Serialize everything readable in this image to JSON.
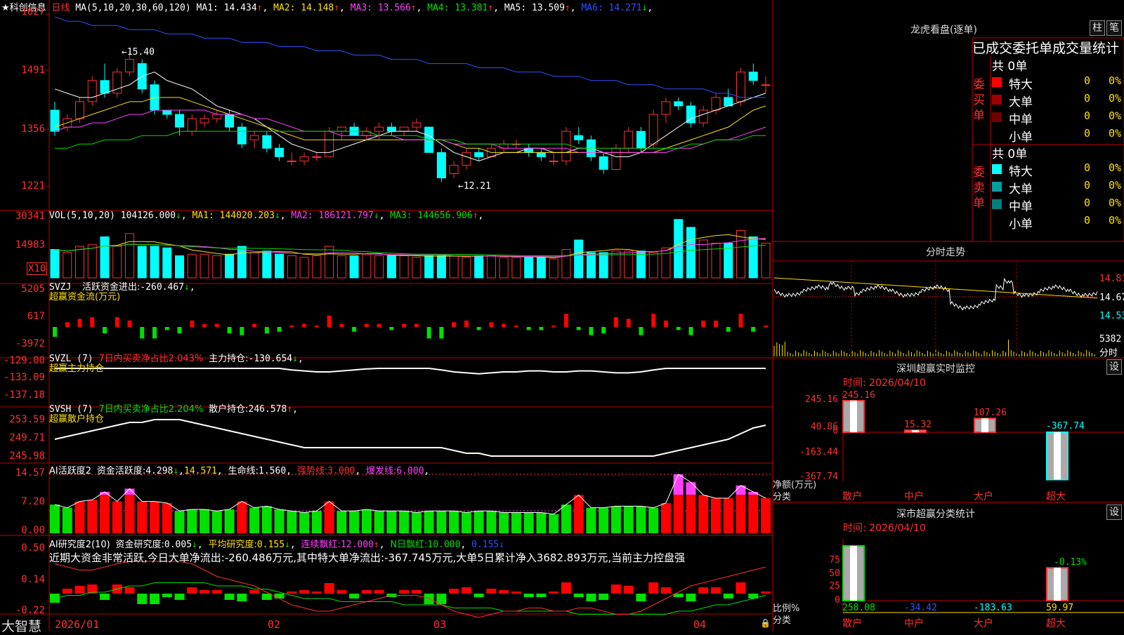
{
  "stock": {
    "name": "科创信息",
    "period": "日线",
    "star": "★"
  },
  "header": {
    "ma_label": "MA(5,10,20,30,60,120)",
    "ma": [
      {
        "name": "MA1",
        "value": "14.434",
        "arrow": "↑",
        "color": "#ffffff"
      },
      {
        "name": "MA2",
        "value": "14.148",
        "arrow": "↑",
        "color": "#ffe000"
      },
      {
        "name": "MA3",
        "value": "13.566",
        "arrow": "↑",
        "color": "#ff40ff"
      },
      {
        "name": "MA4",
        "value": "13.381",
        "arrow": "↑",
        "color": "#00e000"
      },
      {
        "name": "MA5",
        "value": "13.509",
        "arrow": "↑",
        "color": "#ffffff"
      },
      {
        "name": "MA6",
        "value": "14.271",
        "arrow": "↓",
        "color": "#3050ff"
      }
    ]
  },
  "price_axis": [
    "1627",
    "1491",
    "1356",
    "1221"
  ],
  "price_marks": {
    "high": "15.40",
    "low": "12.21"
  },
  "vol": {
    "label": "VOL(5,10,20)",
    "value": "104126.000",
    "arrow": "↓",
    "ma": [
      {
        "name": "MA1",
        "value": "144020.203",
        "arrow": "↓",
        "color": "#ffe000"
      },
      {
        "name": "MA2",
        "value": "186121.797",
        "arrow": "↓",
        "color": "#ff40ff"
      },
      {
        "name": "MA3",
        "value": "144656.906",
        "arrow": "↑",
        "color": "#00e000"
      }
    ],
    "axis": [
      "30341",
      "14983"
    ],
    "unit": "X10"
  },
  "svzj": {
    "label": "SVZJ",
    "text": "活跃资金进出:",
    "value": "-260.467",
    "arrow": "↓",
    "sub": "超赢资金流(万元)",
    "axis": [
      "5205",
      "617",
      "-3972"
    ]
  },
  "svzl": {
    "label": "SVZL (7)",
    "pct_text": "7日内买卖净占比2.043%",
    "text": "主力持仓:",
    "value": "-130.654",
    "arrow": "↓",
    "sub": "超赢主力持仓",
    "axis": [
      "-129.00",
      "-133.09",
      "-137.18"
    ]
  },
  "svsh": {
    "label": "SVSH (7)",
    "pct_text": "7日内买卖净占比2.204%",
    "text": "散户持仓:",
    "value": "246.578",
    "arrow": "↑",
    "sub": "超赢散户持仓",
    "axis": [
      "253.59",
      "249.71",
      "245.98"
    ]
  },
  "ai1": {
    "label": "AI活跃度2",
    "text": "资金活跃度:",
    "value": "4.298",
    "arrow": "↓",
    "v2": "14.571",
    "t3": "生命线:",
    "v3": "1.560",
    "t4": "强势线:",
    "v4": "3.000",
    "t5": "爆发线:",
    "v5": "6.000",
    "axis": [
      "14.57",
      "7.20",
      "0.00"
    ]
  },
  "ai2": {
    "label": "AI研究度2(10)",
    "text": "资金研究度:",
    "value": "0.005",
    "arrow": "↓",
    "t2": "平均研究度:",
    "v2": "0.155",
    "a2": "↓",
    "t3": "连续飘红:",
    "v3": "12.000",
    "a3": "↑",
    "t4": "N日飘红:",
    "v4": "10.000",
    "v5": "0.155",
    "a5": "↓",
    "comment": "近期大资金非常活跃,今日大单净流出:-260.486万元,其中特大单净流出:-367.745万元,大单5日累计净入3682.893万元,当前主力控盘强",
    "axis": [
      "0.50",
      "0.14",
      "-0.22"
    ]
  },
  "dates": [
    "2026/01",
    "02",
    "03",
    "04"
  ],
  "brand": "大智慧",
  "right": {
    "lhb_title": "龙虎看盘(逐单)",
    "buttons": [
      "柱",
      "笔"
    ],
    "stat_title": "已成交委托单成交量统计",
    "buy": {
      "side": "委买单",
      "total": "共 0单",
      "rows": [
        {
          "name": "特大",
          "v": "0",
          "p": "0%",
          "color": "#ff0000"
        },
        {
          "name": "大单",
          "v": "0",
          "p": "0%",
          "color": "#a00000"
        },
        {
          "name": "中单",
          "v": "0",
          "p": "0%",
          "color": "#700000"
        },
        {
          "name": "小单",
          "v": "0",
          "p": "0%",
          "color": "#000000"
        }
      ]
    },
    "sell": {
      "side": "委卖单",
      "total": "共 0单",
      "rows": [
        {
          "name": "特大",
          "v": "0",
          "p": "0%",
          "color": "#00ffff"
        },
        {
          "name": "大单",
          "v": "0",
          "p": "0%",
          "color": "#00a0a0"
        },
        {
          "name": "中单",
          "v": "0",
          "p": "0%",
          "color": "#008080"
        },
        {
          "name": "小单",
          "v": "0",
          "p": "0%",
          "color": "#000000"
        }
      ]
    },
    "intraday": {
      "title": "分时走势",
      "p1": "14.81",
      "p2": "14.67",
      "p3": "14.53",
      "vol": "5382",
      "vol_label": "分时"
    },
    "monitor": {
      "title": "深圳超赢实时监控",
      "btn": "设",
      "time": "时间: 2026/04/10",
      "axis": [
        "245.16",
        "40.86",
        "0",
        "-163.44",
        "-367.74"
      ],
      "ylabel": "净额(万元)",
      "xlabel": "分类",
      "bars": [
        {
          "name": "散户",
          "v": "245.16",
          "n": 245.16
        },
        {
          "name": "中户",
          "v": "15.32",
          "n": 15.32
        },
        {
          "name": "大户",
          "v": "107.26",
          "n": 107.26
        },
        {
          "name": "超大",
          "v": "-367.74",
          "n": -367.74
        }
      ]
    },
    "classify": {
      "title": "深市超赢分类统计",
      "btn": "设",
      "time": "时间: 2026/04/10",
      "axis": [
        "75",
        "50",
        "25",
        "0"
      ],
      "ylabel": "比例%",
      "xlabel": "分类",
      "top_label": "-0.13%",
      "bars": [
        {
          "name": "散户",
          "v": "258.08",
          "n": 100,
          "c": "#00e000"
        },
        {
          "name": "中户",
          "v": "-34.42",
          "n": 0,
          "c": "#3050ff"
        },
        {
          "name": "大户",
          "v": "-183.63",
          "n": 0,
          "c": "#00ffff"
        },
        {
          "name": "超大",
          "v": "59.97",
          "n": 59.97,
          "c": "#ffe000"
        }
      ]
    }
  },
  "chart_data": {
    "type": "candlestick",
    "title": "科创信息 日线",
    "x_start": "2026/01",
    "candles": [
      [
        14.0,
        14.2,
        13.4,
        13.5
      ],
      [
        13.6,
        13.9,
        13.5,
        13.8
      ],
      [
        13.8,
        14.3,
        13.7,
        14.2
      ],
      [
        14.2,
        14.8,
        14.1,
        14.7
      ],
      [
        14.7,
        15.1,
        14.3,
        14.4
      ],
      [
        14.4,
        15.0,
        14.3,
        14.9
      ],
      [
        14.9,
        15.4,
        14.8,
        15.2
      ],
      [
        15.1,
        15.2,
        14.4,
        14.5
      ],
      [
        14.6,
        14.7,
        13.9,
        14.0
      ],
      [
        14.0,
        14.0,
        13.8,
        13.9
      ],
      [
        13.9,
        14.0,
        13.4,
        13.6
      ],
      [
        13.5,
        13.9,
        13.4,
        13.8
      ],
      [
        13.7,
        13.9,
        13.6,
        13.8
      ],
      [
        13.8,
        14.0,
        13.7,
        13.9
      ],
      [
        13.9,
        14.0,
        13.5,
        13.6
      ],
      [
        13.6,
        13.7,
        13.1,
        13.2
      ],
      [
        13.3,
        13.5,
        13.1,
        13.4
      ],
      [
        13.4,
        13.5,
        13.0,
        13.1
      ],
      [
        13.1,
        13.2,
        12.8,
        12.9
      ],
      [
        12.8,
        13.0,
        12.7,
        12.8
      ],
      [
        12.8,
        13.0,
        12.7,
        12.9
      ],
      [
        12.9,
        13.0,
        12.8,
        12.9
      ],
      [
        12.9,
        13.6,
        12.9,
        13.5
      ],
      [
        13.5,
        13.6,
        13.3,
        13.6
      ],
      [
        13.6,
        13.7,
        13.4,
        13.4
      ],
      [
        13.4,
        13.6,
        13.3,
        13.5
      ],
      [
        13.5,
        13.7,
        13.3,
        13.6
      ],
      [
        13.6,
        13.7,
        13.4,
        13.5
      ],
      [
        13.5,
        13.6,
        13.4,
        13.6
      ],
      [
        13.6,
        13.8,
        13.5,
        13.7
      ],
      [
        13.6,
        13.6,
        13.0,
        13.0
      ],
      [
        13.0,
        13.1,
        12.3,
        12.4
      ],
      [
        12.5,
        12.8,
        12.4,
        12.7
      ],
      [
        12.7,
        13.1,
        12.6,
        13.0
      ],
      [
        13.0,
        13.1,
        12.8,
        12.9
      ],
      [
        12.9,
        13.2,
        12.9,
        13.1
      ],
      [
        13.1,
        13.3,
        13.0,
        13.2
      ],
      [
        13.2,
        13.3,
        13.1,
        13.2
      ],
      [
        13.1,
        13.2,
        12.9,
        13.0
      ],
      [
        13.0,
        13.1,
        12.8,
        12.9
      ],
      [
        12.8,
        13.0,
        12.7,
        12.8
      ],
      [
        12.8,
        13.6,
        12.7,
        13.5
      ],
      [
        13.4,
        13.6,
        13.2,
        13.3
      ],
      [
        13.3,
        13.4,
        12.8,
        12.9
      ],
      [
        12.9,
        13.0,
        12.5,
        12.6
      ],
      [
        12.6,
        13.2,
        12.6,
        13.1
      ],
      [
        13.1,
        13.6,
        13.0,
        13.5
      ],
      [
        13.5,
        13.6,
        13.0,
        13.1
      ],
      [
        13.2,
        14.0,
        13.1,
        13.9
      ],
      [
        13.9,
        14.3,
        13.7,
        14.2
      ],
      [
        14.2,
        14.3,
        14.0,
        14.1
      ],
      [
        14.1,
        14.2,
        13.6,
        13.7
      ],
      [
        13.7,
        14.1,
        13.6,
        14.0
      ],
      [
        14.0,
        14.4,
        13.9,
        14.3
      ],
      [
        14.3,
        14.5,
        14.1,
        14.1
      ],
      [
        14.2,
        15.0,
        14.1,
        14.9
      ],
      [
        14.9,
        15.1,
        14.6,
        14.7
      ],
      [
        14.6,
        14.8,
        14.4,
        14.6
      ]
    ],
    "ma_series": [
      {
        "name": "MA1",
        "values": [
          14.5,
          14.4,
          14.3,
          14.3,
          14.4,
          14.5,
          14.6,
          14.8,
          14.9,
          14.7,
          14.6,
          14.5,
          14.3,
          14.1,
          14.0,
          13.9,
          13.8,
          13.6,
          13.4,
          13.2,
          13.1,
          13.0,
          13.0,
          13.1,
          13.2,
          13.3,
          13.4,
          13.5,
          13.5,
          13.5,
          13.4,
          13.2,
          13.0,
          12.9,
          12.8,
          12.9,
          13.0,
          13.0,
          13.1,
          13.1,
          13.0,
          13.0,
          13.1,
          13.1,
          13.0,
          12.9,
          12.9,
          13.0,
          13.2,
          13.4,
          13.6,
          13.8,
          13.9,
          14.0,
          14.1,
          14.2,
          14.3,
          14.4
        ]
      },
      {
        "name": "MA2",
        "values": [
          13.6,
          13.7,
          13.8,
          13.9,
          14.0,
          14.1,
          14.2,
          14.2,
          14.3,
          14.3,
          14.3,
          14.2,
          14.1,
          14.0,
          13.9,
          13.8,
          13.7,
          13.6,
          13.5,
          13.4,
          13.3,
          13.3,
          13.3,
          13.3,
          13.3,
          13.3,
          13.3,
          13.3,
          13.3,
          13.3,
          13.3,
          13.3,
          13.2,
          13.1,
          13.1,
          13.0,
          13.0,
          13.0,
          13.0,
          13.0,
          13.0,
          13.0,
          13.0,
          13.0,
          13.0,
          13.0,
          13.0,
          13.0,
          13.0,
          13.1,
          13.2,
          13.3,
          13.4,
          13.5,
          13.6,
          13.8,
          14.0,
          14.1
        ]
      },
      {
        "name": "MA3",
        "values": [
          13.5,
          13.6,
          13.6,
          13.7,
          13.7,
          13.8,
          13.9,
          13.9,
          14.0,
          14.0,
          14.0,
          14.0,
          14.0,
          13.9,
          13.9,
          13.9,
          13.8,
          13.8,
          13.7,
          13.6,
          13.5,
          13.5,
          13.5,
          13.4,
          13.4,
          13.4,
          13.4,
          13.4,
          13.3,
          13.3,
          13.3,
          13.3,
          13.2,
          13.2,
          13.2,
          13.2,
          13.1,
          13.1,
          13.1,
          13.1,
          13.1,
          13.1,
          13.0,
          13.0,
          13.0,
          13.0,
          13.0,
          13.0,
          13.0,
          13.0,
          13.1,
          13.1,
          13.2,
          13.3,
          13.3,
          13.4,
          13.5,
          13.6
        ]
      },
      {
        "name": "MA4",
        "values": [
          13.1,
          13.1,
          13.2,
          13.2,
          13.3,
          13.3,
          13.3,
          13.4,
          13.4,
          13.4,
          13.5,
          13.5,
          13.5,
          13.5,
          13.5,
          13.5,
          13.5,
          13.5,
          13.5,
          13.5,
          13.5,
          13.5,
          13.5,
          13.5,
          13.5,
          13.5,
          13.4,
          13.4,
          13.4,
          13.4,
          13.3,
          13.3,
          13.3,
          13.2,
          13.2,
          13.2,
          13.2,
          13.2,
          13.2,
          13.2,
          13.2,
          13.2,
          13.1,
          13.1,
          13.1,
          13.1,
          13.1,
          13.1,
          13.1,
          13.1,
          13.1,
          13.2,
          13.2,
          13.3,
          13.3,
          13.3,
          13.4,
          13.4
        ]
      },
      {
        "name": "MA6",
        "values": [
          16.2,
          16.1,
          16.1,
          16.0,
          16.0,
          16.0,
          15.9,
          15.9,
          15.9,
          15.8,
          15.8,
          15.8,
          15.7,
          15.7,
          15.7,
          15.6,
          15.6,
          15.6,
          15.5,
          15.5,
          15.5,
          15.4,
          15.4,
          15.4,
          15.3,
          15.3,
          15.3,
          15.2,
          15.2,
          15.2,
          15.1,
          15.1,
          15.1,
          15.1,
          15.0,
          15.0,
          15.0,
          14.9,
          14.9,
          14.9,
          14.8,
          14.8,
          14.8,
          14.7,
          14.7,
          14.7,
          14.6,
          14.6,
          14.6,
          14.5,
          14.5,
          14.5,
          14.5,
          14.4,
          14.4,
          14.3,
          14.3,
          14.3
        ]
      }
    ],
    "volume": [
      18,
      16,
      20,
      21,
      26,
      20,
      28,
      20,
      20,
      19,
      14,
      15,
      15,
      14,
      15,
      20,
      16,
      17,
      15,
      14,
      13,
      14,
      20,
      14,
      14,
      15,
      14,
      14,
      14,
      13,
      14,
      14,
      14,
      13,
      14,
      14,
      13,
      13,
      13,
      13,
      12,
      18,
      24,
      16,
      16,
      17,
      17,
      17,
      16,
      19,
      37,
      32,
      24,
      22,
      22,
      30,
      26,
      22
    ]
  }
}
